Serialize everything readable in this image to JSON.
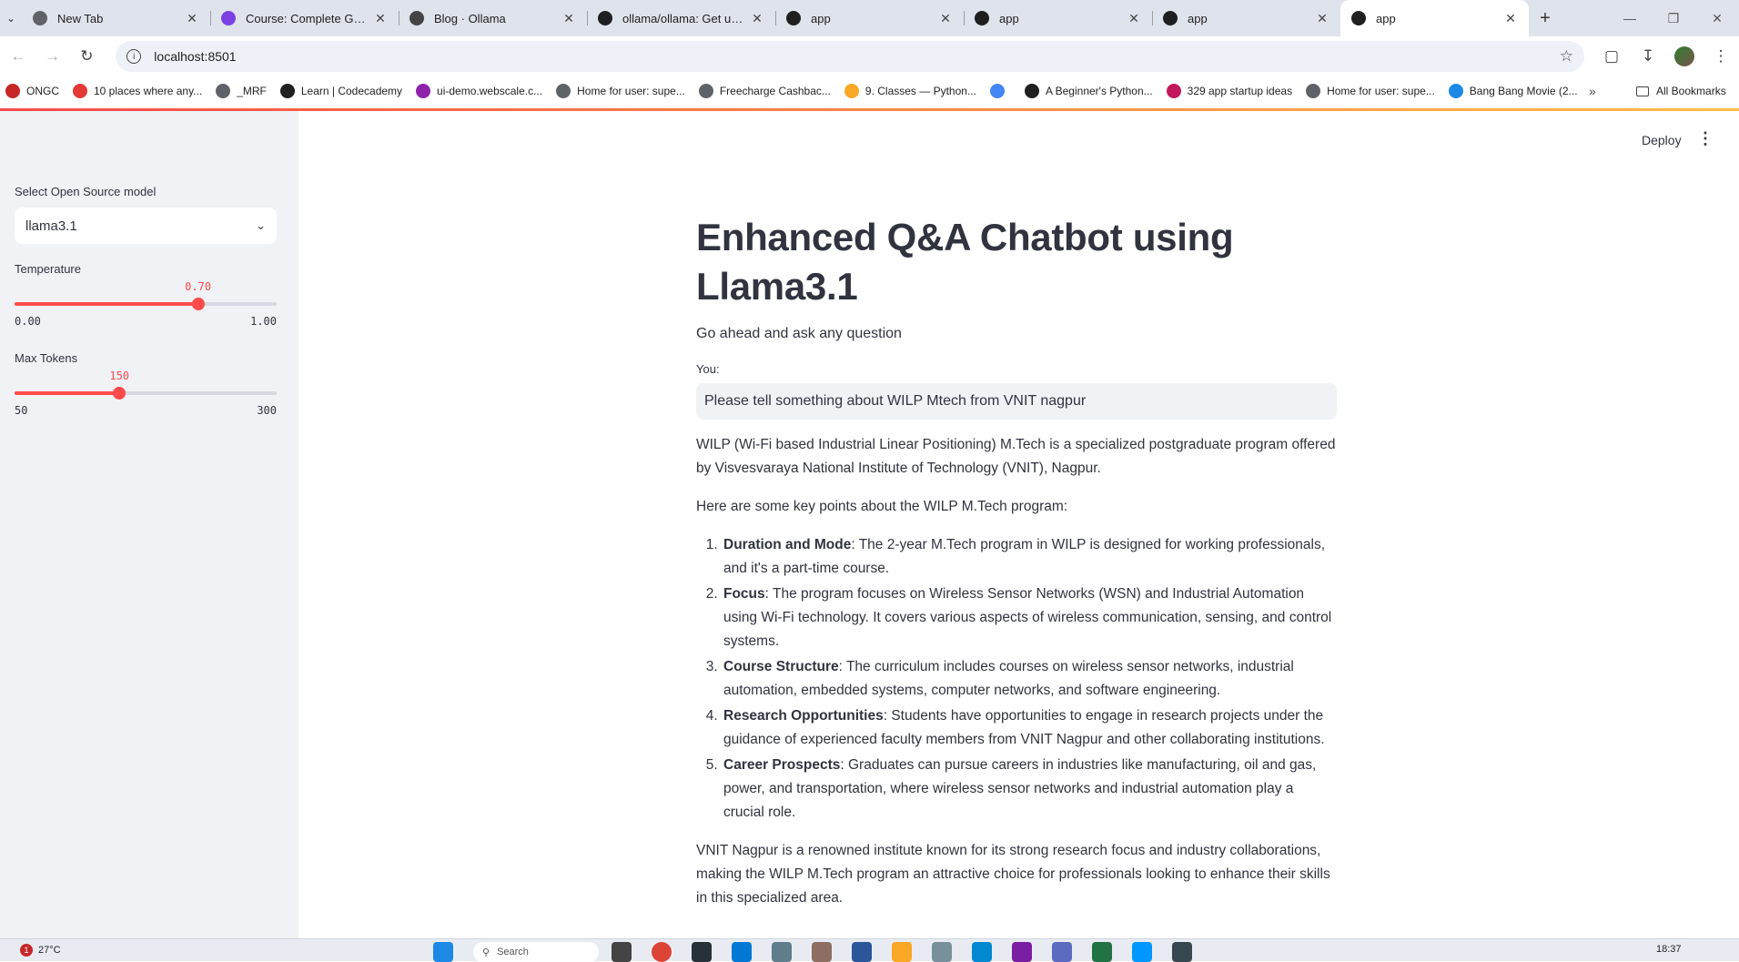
{
  "browser": {
    "tabs": [
      {
        "title": "New Tab",
        "icon": "chrome-icon",
        "color": "#5f6368"
      },
      {
        "title": "Course: Complete Generative AI",
        "icon": "course-icon",
        "color": "#7b3fe4"
      },
      {
        "title": "Blog · Ollama",
        "icon": "ollama-icon",
        "color": "#444444"
      },
      {
        "title": "ollama/ollama: Get up and running",
        "icon": "github-icon",
        "color": "#1f1f1f"
      },
      {
        "title": "app",
        "icon": "streamlit-icon",
        "color": "#1f1f1f"
      },
      {
        "title": "app",
        "icon": "streamlit-icon",
        "color": "#1f1f1f"
      },
      {
        "title": "app",
        "icon": "streamlit-icon",
        "color": "#1f1f1f"
      },
      {
        "title": "app",
        "icon": "streamlit-icon",
        "color": "#1f1f1f",
        "active": true
      }
    ],
    "url": "localhost:8501",
    "bookmarks": [
      {
        "label": "ONGC",
        "color": "#c62828"
      },
      {
        "label": "10 places where any...",
        "color": "#e53935"
      },
      {
        "label": "_MRF",
        "color": "#5f6368"
      },
      {
        "label": "Learn | Codecademy",
        "color": "#1f1f1f"
      },
      {
        "label": "ui-demo.webscale.c...",
        "color": "#8e24aa"
      },
      {
        "label": "Home for user: supe...",
        "color": "#5f6368"
      },
      {
        "label": "Freecharge Cashbac...",
        "color": "#5f6368"
      },
      {
        "label": "9. Classes — Python...",
        "color": "#f9a825"
      },
      {
        "label": "",
        "color": "#4285f4"
      },
      {
        "label": "A Beginner's Python...",
        "color": "#1f1f1f"
      },
      {
        "label": "329 app startup ideas",
        "color": "#c2185b"
      },
      {
        "label": "Home for user: supe...",
        "color": "#5f6368"
      },
      {
        "label": "Bang Bang Movie (2...",
        "color": "#1e88e5"
      }
    ],
    "all_bookmarks": "All Bookmarks"
  },
  "sidebar": {
    "model_label": "Select Open Source model",
    "model_value": "llama3.1",
    "temperature": {
      "label": "Temperature",
      "value": 0.7,
      "value_text": "0.70",
      "min": 0,
      "max": 1,
      "min_text": "0.00",
      "max_text": "1.00"
    },
    "max_tokens": {
      "label": "Max Tokens",
      "value": 150,
      "value_text": "150",
      "min": 50,
      "max": 300,
      "min_text": "50",
      "max_text": "300"
    }
  },
  "header": {
    "deploy_label": "Deploy"
  },
  "main": {
    "title": "Enhanced Q&A Chatbot using Llama3.1",
    "subtitle": "Go ahead and ask any question",
    "input_label": "You:",
    "input_value": "Please tell something about WILP Mtech from VNIT nagpur",
    "answer": {
      "intro": "WILP (Wi-Fi based Industrial Linear Positioning) M.Tech is a specialized postgraduate program offered by Visvesvaraya National Institute of Technology (VNIT), Nagpur.",
      "lead": "Here are some key points about the WILP M.Tech program:",
      "points": [
        {
          "term": "Duration and Mode",
          "text": ": The 2-year M.Tech program in WILP is designed for working professionals, and it's a part-time course."
        },
        {
          "term": "Focus",
          "text": ": The program focuses on Wireless Sensor Networks (WSN) and Industrial Automation using Wi-Fi technology. It covers various aspects of wireless communication, sensing, and control systems."
        },
        {
          "term": "Course Structure",
          "text": ": The curriculum includes courses on wireless sensor networks, industrial automation, embedded systems, computer networks, and software engineering."
        },
        {
          "term": "Research Opportunities",
          "text": ": Students have opportunities to engage in research projects under the guidance of experienced faculty members from VNIT Nagpur and other collaborating institutions."
        },
        {
          "term": "Career Prospects",
          "text": ": Graduates can pursue careers in industries like manufacturing, oil and gas, power, and transportation, where wireless sensor networks and industrial automation play a crucial role."
        }
      ],
      "outro": "VNIT Nagpur is a renowned institute known for its strong research focus and industry collaborations, making the WILP M.Tech program an attractive choice for professionals looking to enhance their skills in this specialized area."
    }
  },
  "taskbar": {
    "weather_badge": "1",
    "weather": "27°C",
    "search_placeholder": "Search",
    "clock": "18:37"
  },
  "colors": {
    "accent": "#ff4b4b",
    "sidebar_bg": "#f0f2f6",
    "text": "#31333f"
  }
}
